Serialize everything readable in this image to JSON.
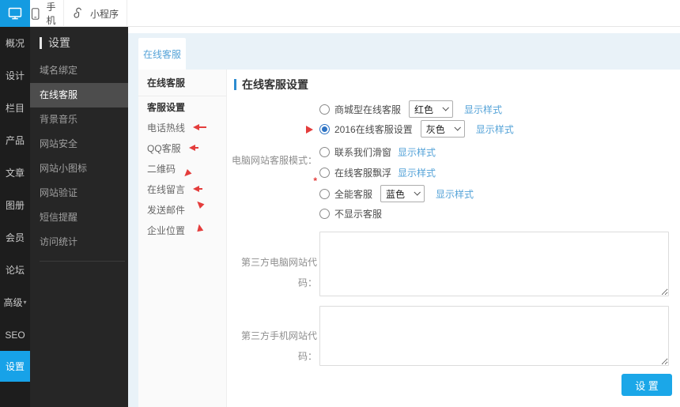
{
  "topbar": {
    "pc_icon": "monitor-icon",
    "mobile_label": "手机",
    "mobile_icon": "phone-icon",
    "miniprogram_label": "小程序",
    "miniprogram_icon": "s-curve-icon"
  },
  "rail": {
    "items": [
      {
        "label": "概况"
      },
      {
        "label": "设计"
      },
      {
        "label": "栏目"
      },
      {
        "label": "产品"
      },
      {
        "label": "文章"
      },
      {
        "label": "图册"
      },
      {
        "label": "会员"
      },
      {
        "label": "论坛"
      },
      {
        "label": "高级",
        "caret": "▾"
      },
      {
        "label": "SEO"
      },
      {
        "label": "设置",
        "active": true
      }
    ]
  },
  "settings_nav": {
    "header": "设置",
    "items": [
      {
        "label": "域名绑定"
      },
      {
        "label": "在线客服",
        "active": true
      },
      {
        "label": "背景音乐"
      },
      {
        "label": "网站安全"
      },
      {
        "label": "网站小图标"
      },
      {
        "label": "网站验证"
      },
      {
        "label": "短信提醒"
      },
      {
        "label": "访问统计"
      }
    ]
  },
  "tab": {
    "label": "在线客服"
  },
  "submenu": {
    "header": "在线客服",
    "section": "客服设置",
    "items": [
      {
        "label": "电话热线",
        "arrow": "left-tail-arrow"
      },
      {
        "label": "QQ客服",
        "arrow": "left-tail-arrow"
      },
      {
        "label": "二维码",
        "arrow": "down-left-arrowhead"
      },
      {
        "label": "在线留言",
        "arrow": "left-tail-arrow"
      },
      {
        "label": "发送邮件",
        "arrow": "up-left-arrowhead"
      },
      {
        "label": "企业位置",
        "arrow": "up-arrowhead"
      }
    ]
  },
  "form": {
    "title": "在线客服设置",
    "row_mall": {
      "label": "商城型在线客服",
      "select_value": "红色",
      "link": "显示样式",
      "selected": false
    },
    "row_2016": {
      "label": "2016在线客服设置",
      "select_value": "灰色",
      "link": "显示样式",
      "selected": true,
      "pointer": "right-arrowhead"
    },
    "mode_label": "电脑网站客服模式：",
    "required_mark": "*",
    "row_contact": {
      "label": "联系我们滑窗",
      "link": "显示样式",
      "selected": false
    },
    "row_float": {
      "label": "在线客服飘浮",
      "link": "显示样式",
      "selected": false
    },
    "row_almighty": {
      "label": "全能客服",
      "select_value": "蓝色",
      "link": "显示样式",
      "selected": false
    },
    "row_hide": {
      "label": "不显示客服",
      "selected": false
    },
    "pc_code_label": "第三方电脑网站代码：",
    "mobile_code_label": "第三方手机网站代码：",
    "pc_code_value": "",
    "mobile_code_value": "",
    "submit_label": "设 置"
  },
  "colors": {
    "accent_blue": "#17a2e8",
    "link_blue": "#55a3d8",
    "annotation_red": "#e43d3c",
    "sidebar_dark": "#1d1d1d",
    "panel_dark": "#262626",
    "tabstrip_blue": "#e9f2f8"
  }
}
